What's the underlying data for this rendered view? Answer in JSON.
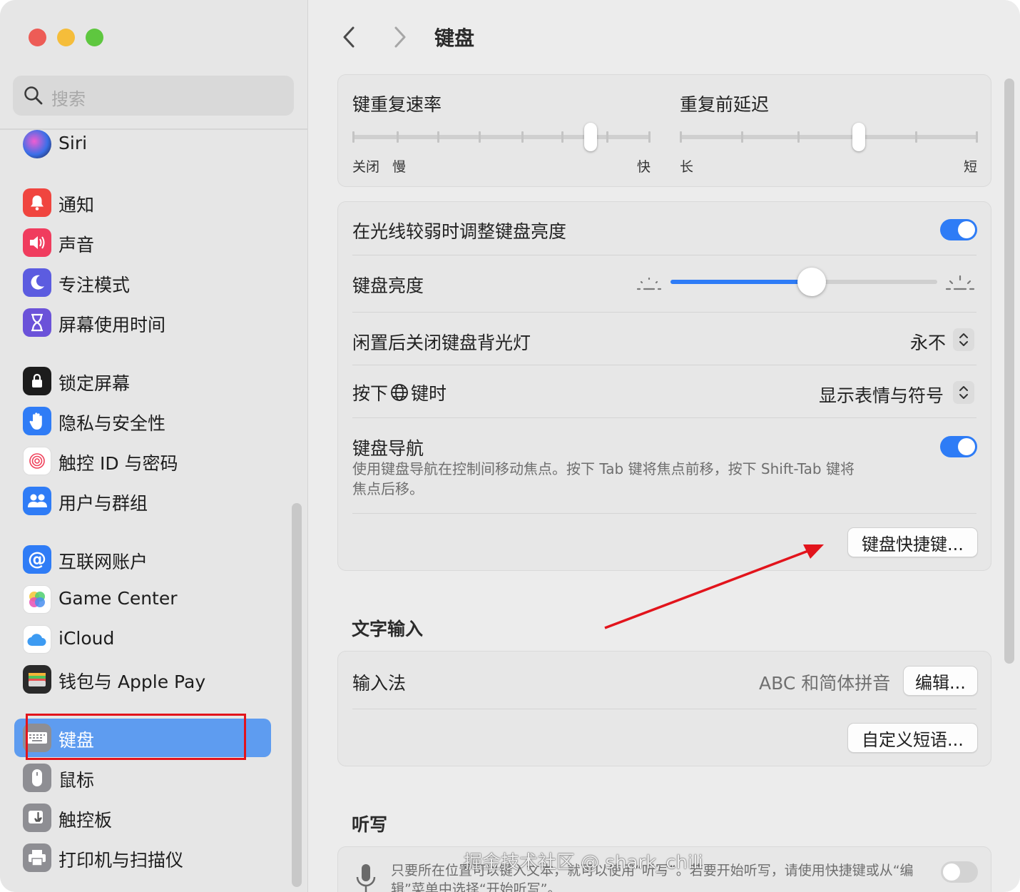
{
  "window": {
    "traffic_lights": {
      "close": "#ed5c56",
      "minimize": "#f5bd3a",
      "zoom": "#5ec73f"
    }
  },
  "sidebar": {
    "search_placeholder": "搜索",
    "items": [
      {
        "id": "siri",
        "label": "Siri",
        "icon": "siri-icon",
        "color": "#4a4a8a"
      },
      {
        "id": "notifications",
        "label": "通知",
        "icon": "bell-icon",
        "color": "#f0453f"
      },
      {
        "id": "sound",
        "label": "声音",
        "icon": "speaker-icon",
        "color": "#f03c5e"
      },
      {
        "id": "focus",
        "label": "专注模式",
        "icon": "moon-icon",
        "color": "#5c5ce0"
      },
      {
        "id": "screentime",
        "label": "屏幕使用时间",
        "icon": "hourglass-icon",
        "color": "#6b52d9"
      },
      {
        "id": "lockscreen",
        "label": "锁定屏幕",
        "icon": "lock-icon",
        "color": "#1c1c1c"
      },
      {
        "id": "privacy",
        "label": "隐私与安全性",
        "icon": "hand-icon",
        "color": "#2f7cf6"
      },
      {
        "id": "touchid",
        "label": "触控 ID 与密码",
        "icon": "fingerprint-icon",
        "color": "#ffffff"
      },
      {
        "id": "users",
        "label": "用户与群组",
        "icon": "users-icon",
        "color": "#2f7cf6"
      },
      {
        "id": "internet",
        "label": "互联网账户",
        "icon": "at-icon",
        "color": "#2f7cf6"
      },
      {
        "id": "gamecenter",
        "label": "Game Center",
        "icon": "gamecenter-icon",
        "color": "#ffffff"
      },
      {
        "id": "icloud",
        "label": "iCloud",
        "icon": "cloud-icon",
        "color": "#ffffff"
      },
      {
        "id": "wallet",
        "label": "钱包与 Apple Pay",
        "icon": "wallet-icon",
        "color": "#2a2a2a"
      },
      {
        "id": "keyboard",
        "label": "键盘",
        "icon": "keyboard-icon",
        "color": "#8e8e93",
        "selected": true
      },
      {
        "id": "mouse",
        "label": "鼠标",
        "icon": "mouse-icon",
        "color": "#8e8e93"
      },
      {
        "id": "trackpad",
        "label": "触控板",
        "icon": "trackpad-icon",
        "color": "#8e8e93"
      },
      {
        "id": "printers",
        "label": "打印机与扫描仪",
        "icon": "printer-icon",
        "color": "#8e8e93"
      }
    ]
  },
  "header": {
    "title": "键盘",
    "back_icon": "chevron-left-icon",
    "forward_icon": "chevron-right-icon"
  },
  "repeat": {
    "rate_label": "键重复速率",
    "rate_off": "关闭",
    "rate_slow": "慢",
    "rate_fast": "快",
    "rate_level": 0.8,
    "delay_label": "重复前延迟",
    "delay_long": "长",
    "delay_short": "短",
    "delay_level": 0.6
  },
  "backlight": {
    "auto_adjust_label": "在光线较弱时调整键盘亮度",
    "auto_adjust_on": true,
    "brightness_label": "键盘亮度",
    "brightness_level": 0.53,
    "turn_off_label": "闲置后关闭键盘背光灯",
    "turn_off_value": "永不",
    "globe_label_pre": "按下",
    "globe_label_post": "键时",
    "globe_value": "显示表情与符号",
    "nav_label": "键盘导航",
    "nav_on": true,
    "nav_desc": "使用键盘导航在控制间移动焦点。按下 Tab 键将焦点前移，按下 Shift-Tab 键将焦点后移。",
    "shortcuts_button": "键盘快捷键..."
  },
  "text_input": {
    "section_title": "文字输入",
    "input_sources_label": "输入法",
    "input_sources_value": "ABC 和简体拼音",
    "edit_button": "编辑...",
    "replacements_button": "自定义短语..."
  },
  "dictation": {
    "section_title": "听写",
    "desc": "只要所在位置可以键入文本，就可以使用“听写”。若要开始听写，请使用快捷键或从“编辑”菜单中选择“开始听写”。",
    "enabled": false
  },
  "watermark": "掘金技术社区 @ shark_chili",
  "annotation": {
    "color": "#e2141c"
  }
}
